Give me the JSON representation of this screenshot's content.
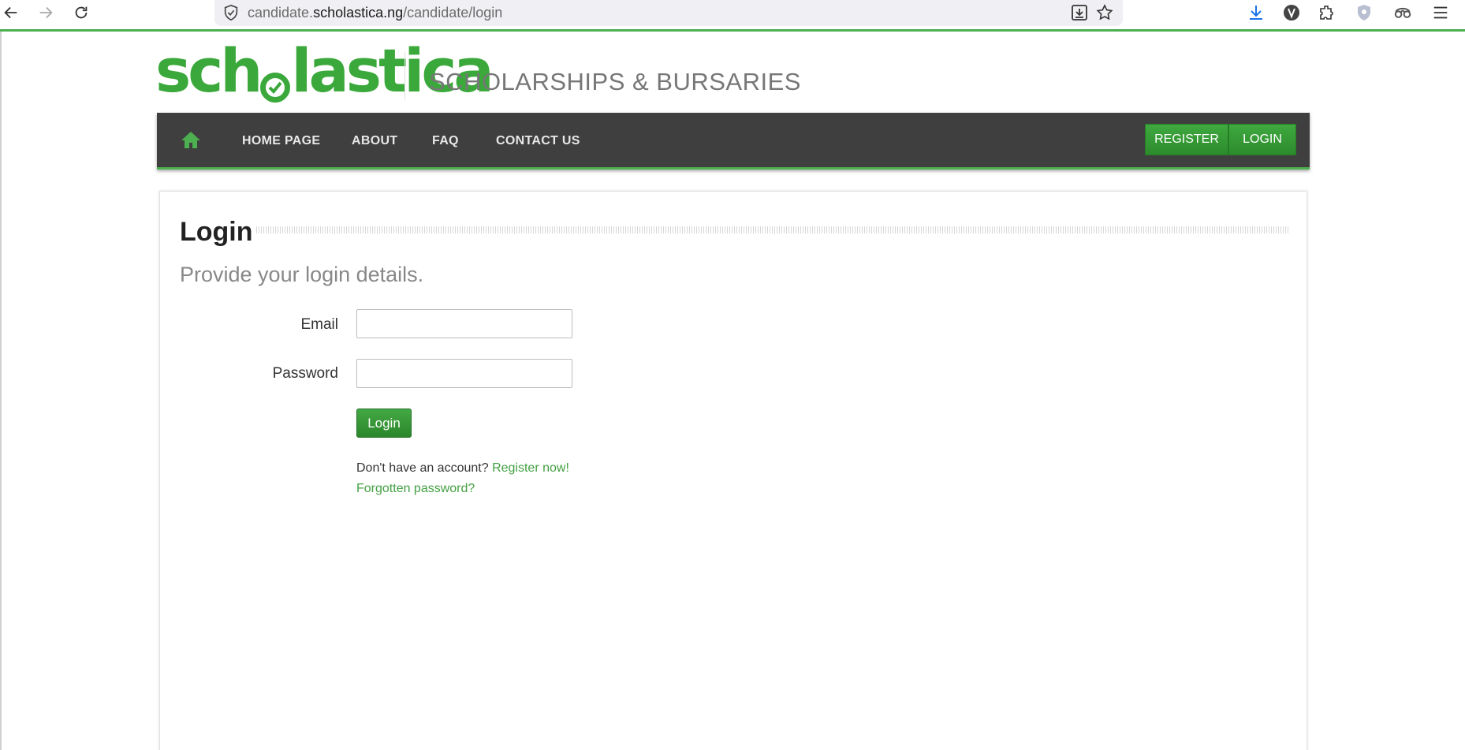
{
  "browser": {
    "url_prefix": "candidate.",
    "url_domain": "scholastica.ng",
    "url_path": "/candidate/login"
  },
  "site": {
    "logo_left": "sch",
    "logo_right": "lastica",
    "tagline": "SCHOLARSHIPS & BURSARIES"
  },
  "nav": {
    "links": [
      "HOME PAGE",
      "ABOUT",
      "FAQ",
      "CONTACT US"
    ],
    "register": "REGISTER",
    "login": "LOGIN"
  },
  "main": {
    "title": "Login",
    "subtitle": "Provide your login details.",
    "email_label": "Email",
    "email_value": "",
    "password_label": "Password",
    "password_value": "",
    "submit_label": "Login",
    "no_account_text": "Don't have an account?",
    "register_link": "Register now!",
    "forgot_link": "Forgotten password?"
  },
  "colors": {
    "brand_green": "#3aa83a",
    "nav_background": "#3f3f3f",
    "link_green": "#43a043"
  }
}
